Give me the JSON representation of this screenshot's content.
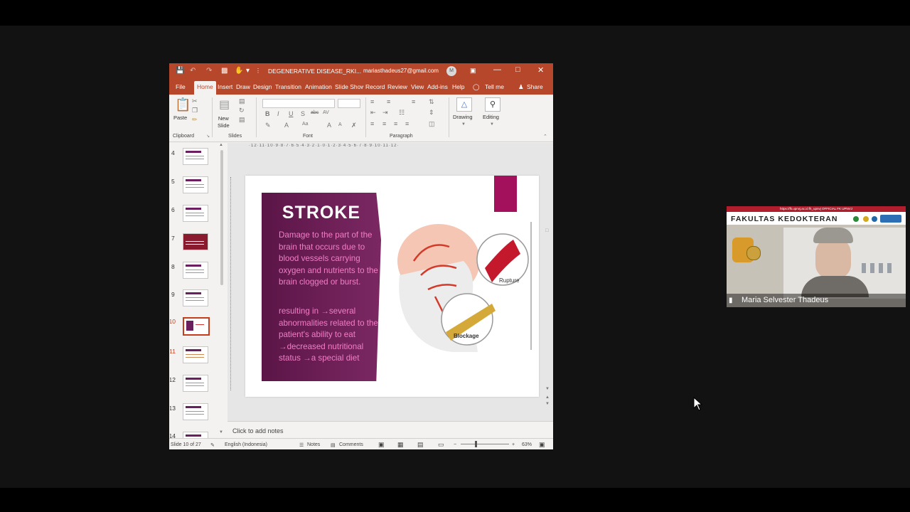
{
  "window": {
    "doc_title": "DEGENERATIVE DISEASE_RKI...",
    "account": "mariasthadeus27@gmail.com",
    "avatar_letter": "M"
  },
  "menu": [
    "File",
    "Home",
    "Insert",
    "Draw",
    "Design",
    "Transitions",
    "Animation",
    "Slide Show",
    "Record",
    "Review",
    "View",
    "Add-ins",
    "Help",
    "Tell me",
    "Share"
  ],
  "ribbon": {
    "paste": "Paste",
    "new_slide": "New\nSlide",
    "drawing": "Drawing",
    "editing": "Editing",
    "groups": [
      "Clipboard",
      "Slides",
      "Font",
      "Paragraph"
    ]
  },
  "thumbnails": [
    "4",
    "5",
    "6",
    "7",
    "8",
    "9",
    "10",
    "11",
    "12",
    "13",
    "14"
  ],
  "slide": {
    "title": "STROKE",
    "para1": "Damage to the part of the brain that occurs due to blood vessels carrying oxygen and nutrients to the brain clogged or burst.",
    "para2": "resulting in →several abnormalities related to the patient's ability to eat →decreased nutritional status →a special diet",
    "label_rupture": "Rupture",
    "label_blockage": "Blockage"
  },
  "notes_placeholder": "Click to add notes",
  "status": {
    "slide_info": "Slide 10 of 27",
    "language": "English (Indonesia)",
    "notes": "Notes",
    "comments": "Comments",
    "zoom": "63%"
  },
  "video": {
    "top_line": "https://fk.upnvj.ac.id  fk_upnvj  OFFICIAL FK UPNVJ",
    "banner": "FAKULTAS KEDOKTERAN",
    "participant": "Maria Selvester Thadeus"
  },
  "colors": {
    "accent": "#b7472a",
    "slide_panel": "#6b1f5e",
    "slide_text": "#f27ec6",
    "pink_block": "#a3105b"
  }
}
